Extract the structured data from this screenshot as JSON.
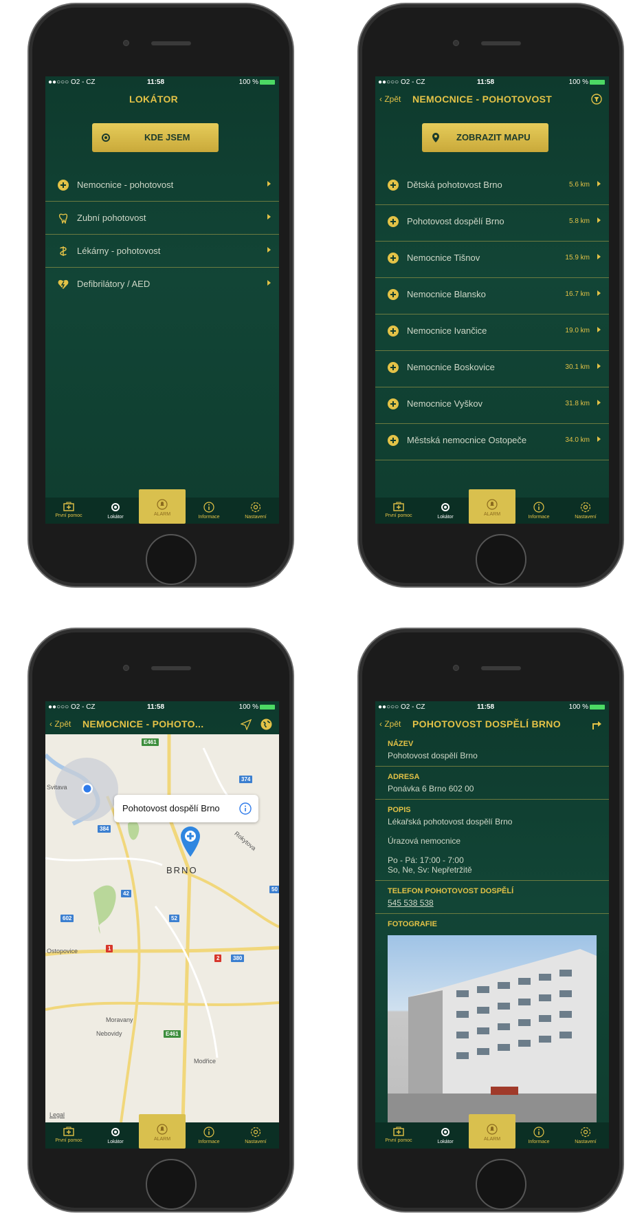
{
  "status": {
    "carrier": "●●○○○ O2 - CZ",
    "time": "11:58",
    "battery": "100 %"
  },
  "tabs": [
    "První pomoc",
    "Lokátor",
    "ALARM",
    "Informace",
    "Nastavení"
  ],
  "screen1": {
    "title": "LOKÁTOR",
    "button": "KDE JSEM",
    "items": [
      {
        "label": "Nemocnice - pohotovost",
        "icon": "plus-circle-icon"
      },
      {
        "label": "Zubní pohotovost",
        "icon": "tooth-icon"
      },
      {
        "label": "Lékárny - pohotovost",
        "icon": "pharmacy-icon"
      },
      {
        "label": "Defibrilátory / AED",
        "icon": "heart-bolt-icon"
      }
    ]
  },
  "screen2": {
    "back": "Zpět",
    "title": "NEMOCNICE - POHOTOVOST",
    "button": "ZOBRAZIT MAPU",
    "items": [
      {
        "label": "Dětská pohotovost Brno",
        "distance": "5.6 km"
      },
      {
        "label": "Pohotovost dospělí Brno",
        "distance": "5.8 km"
      },
      {
        "label": "Nemocnice Tišnov",
        "distance": "15.9 km"
      },
      {
        "label": "Nemocnice Blansko",
        "distance": "16.7 km"
      },
      {
        "label": "Nemocnice Ivančice",
        "distance": "19.0 km"
      },
      {
        "label": "Nemocnice Boskovice",
        "distance": "30.1 km"
      },
      {
        "label": "Nemocnice Vyškov",
        "distance": "31.8 km"
      },
      {
        "label": "Městská nemocnice Ostopeče",
        "distance": "34.0 km"
      }
    ]
  },
  "screen3": {
    "back": "Zpět",
    "title": "NEMOCNICE - POHOTO...",
    "callout": "Pohotovost dospělí Brno",
    "map_labels": {
      "city": "BRNO",
      "ostopovice": "Ostopovice",
      "moravany": "Moravany",
      "nebovidy": "Nebovidy",
      "modrice": "Modřice",
      "legal": "Legal",
      "svitavka": "Svitava",
      "rokytova": "Rokytova"
    },
    "shields": {
      "e461a": "E461",
      "r374": "374",
      "r384": "384",
      "r42": "42",
      "r50": "50",
      "r602": "602",
      "r52": "52",
      "r1": "1",
      "r2": "2",
      "r380": "380",
      "e461b": "E461"
    }
  },
  "screen4": {
    "back": "Zpět",
    "title": "POHOTOVOST DOSPĚLÍ BRNO",
    "name_label": "NÁZEV",
    "name": "Pohotovost dospělí Brno",
    "address_label": "ADRESA",
    "address": "Ponávka 6 Brno 602 00",
    "desc_label": "POPIS",
    "desc1": "Lékařská pohotovost dospělí Brno",
    "desc2": "Úrazová nemocnice",
    "hours1": "Po - Pá: 17:00 - 7:00",
    "hours2": "So, Ne, Sv: Nepřetržitě",
    "phone_label": "TELEFON POHOTOVOST DOSPĚLÍ",
    "phone": "545 538 538",
    "photo_label": "FOTOGRAFIE"
  },
  "colors": {
    "accent": "#e3c247",
    "background": "#0f3b2e",
    "tabbar": "#0b2f24",
    "alarm": "#d9c04e"
  }
}
